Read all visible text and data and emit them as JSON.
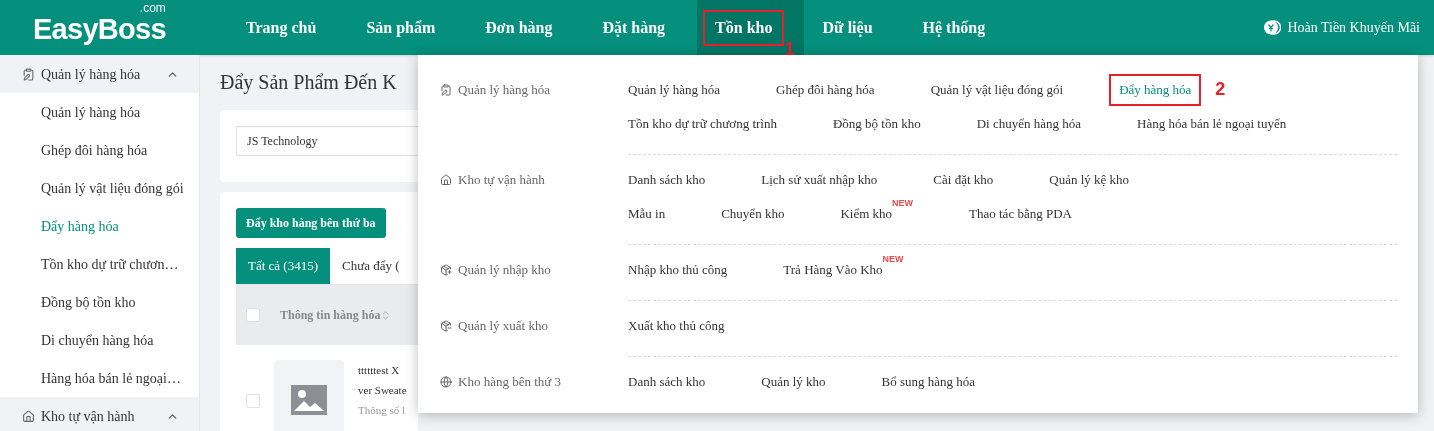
{
  "logo": {
    "name": "EasyBoss",
    "suffix": ".com"
  },
  "nav": [
    {
      "label": "Trang chủ",
      "selected": false
    },
    {
      "label": "Sản phẩm",
      "selected": false
    },
    {
      "label": "Đơn hàng",
      "selected": false
    },
    {
      "label": "Đặt hàng",
      "selected": false
    },
    {
      "label": "Tồn kho",
      "selected": true,
      "marker": "1"
    },
    {
      "label": "Dữ liệu",
      "selected": false
    },
    {
      "label": "Hệ thống",
      "selected": false
    }
  ],
  "promo": "Hoàn Tiền Khuyến Mãi",
  "sidebar": [
    {
      "label": "Quản lý hàng hóa",
      "expanded": true,
      "children": [
        {
          "label": "Quản lý hàng hóa",
          "selected": false
        },
        {
          "label": "Ghép đôi hàng hóa",
          "selected": false
        },
        {
          "label": "Quản lý vật liệu đóng gói",
          "selected": false
        },
        {
          "label": "Đẩy hàng hóa",
          "selected": true
        },
        {
          "label": "Tồn kho dự trữ chươn…",
          "selected": false
        },
        {
          "label": "Đồng bộ tồn kho",
          "selected": false
        },
        {
          "label": "Di chuyển hàng hóa",
          "selected": false
        },
        {
          "label": "Hàng hóa bán lẻ ngoại…",
          "selected": false
        }
      ]
    },
    {
      "label": "Kho tự vận hành",
      "expanded": true
    }
  ],
  "page": {
    "title": "Đẩy Sản Phẩm Đến K",
    "shop_select": "JS Technology",
    "push_button": "Đẩy kho hàng bên thứ ba",
    "tabs": [
      {
        "label": "Tất cả (3415)",
        "selected": true
      },
      {
        "label": "Chưa đẩy (",
        "selected": false
      }
    ],
    "table": {
      "select_all": false,
      "columns": [
        "Thông tin hàng hóa"
      ],
      "rows": [
        {
          "checked": false,
          "lines": [
            "ttttttest X",
            "ver Sweate",
            "Thông số l"
          ]
        }
      ]
    }
  },
  "menu": [
    {
      "label": "Quản lý hàng hóa",
      "lines": [
        [
          {
            "label": "Quản lý hàng hóa",
            "selected": false
          },
          {
            "label": "Ghép đôi hàng hóa",
            "selected": false
          },
          {
            "label": "Quản lý vật liệu đóng gói",
            "selected": false
          },
          {
            "label": "Đẩy hàng hóa",
            "selected": true,
            "marker": "2"
          }
        ],
        [
          {
            "label": "Tồn kho dự trữ chương trình",
            "selected": false
          },
          {
            "label": "Đồng bộ tồn kho",
            "selected": false
          },
          {
            "label": "Di chuyển hàng hóa",
            "selected": false
          },
          {
            "label": "Hàng hóa bán lẻ ngoại tuyến",
            "selected": false
          }
        ]
      ]
    },
    {
      "label": "Kho tự vận hành",
      "lines": [
        [
          {
            "label": "Danh sách kho",
            "selected": false
          },
          {
            "label": "Lịch sử xuất nhập kho",
            "selected": false
          },
          {
            "label": "Cài đặt kho",
            "selected": false
          },
          {
            "label": "Quản lý kệ kho",
            "selected": false
          }
        ],
        [
          {
            "label": "Mẫu in",
            "selected": false
          },
          {
            "label": "Chuyển kho",
            "selected": false
          },
          {
            "label": "Kiểm kho",
            "selected": false,
            "badge": "NEW"
          },
          {
            "label": "Thao tác bằng PDA",
            "selected": false
          }
        ]
      ]
    },
    {
      "label": "Quản lý nhập kho",
      "lines": [
        [
          {
            "label": "Nhập kho thủ công",
            "selected": false
          },
          {
            "label": "Trả Hàng Vào Kho",
            "selected": false,
            "badge": "NEW"
          }
        ]
      ]
    },
    {
      "label": "Quản lý xuất kho",
      "lines": [
        [
          {
            "label": "Xuất kho thủ công",
            "selected": false
          }
        ]
      ]
    },
    {
      "label": "Kho hàng bên thứ 3",
      "lines": [
        [
          {
            "label": "Danh sách kho",
            "selected": false
          },
          {
            "label": "Quản lý kho",
            "selected": false
          },
          {
            "label": "Bổ sung hàng hóa",
            "selected": false
          }
        ]
      ]
    }
  ]
}
